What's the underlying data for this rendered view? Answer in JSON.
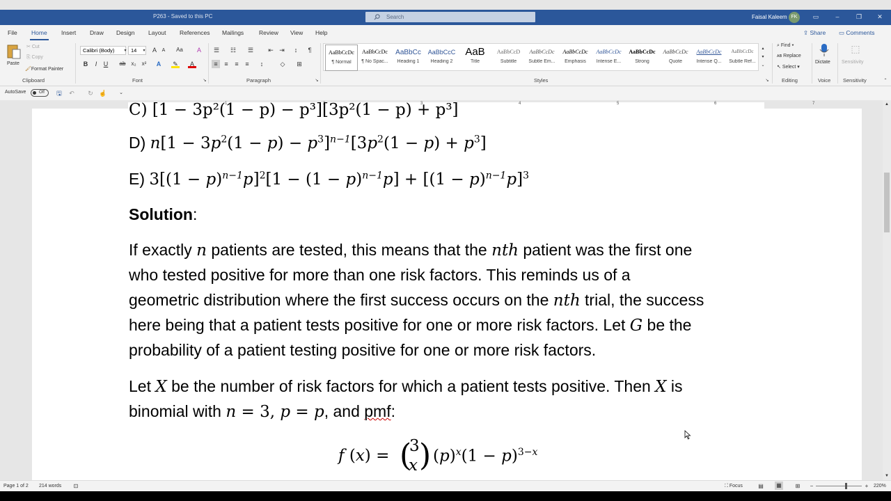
{
  "window": {
    "doc_title": "P263  -  Saved to this PC",
    "search_placeholder": "Search",
    "user_name": "Faisal Kaleem",
    "user_initials": "FK"
  },
  "tabs": [
    "File",
    "Home",
    "Insert",
    "Draw",
    "Design",
    "Layout",
    "References",
    "Mailings",
    "Review",
    "View",
    "Help"
  ],
  "active_tab": "Home",
  "share_label": "Share",
  "comments_label": "Comments",
  "ribbon": {
    "clipboard": {
      "paste": "Paste",
      "cut": "Cut",
      "copy": "Copy",
      "format_painter": "Format Painter",
      "label": "Clipboard"
    },
    "font": {
      "name": "Calibri (Body)",
      "size": "14",
      "label": "Font"
    },
    "paragraph": {
      "label": "Paragraph"
    },
    "styles": {
      "label": "Styles",
      "items": [
        {
          "preview": "AaBbCcDc",
          "name": "¶ Normal"
        },
        {
          "preview": "AaBbCcDc",
          "name": "¶ No Spac..."
        },
        {
          "preview": "AaBbCc",
          "name": "Heading 1"
        },
        {
          "preview": "AaBbCcC",
          "name": "Heading 2"
        },
        {
          "preview": "AaB",
          "name": "Title"
        },
        {
          "preview": "AaBbCcD",
          "name": "Subtitle"
        },
        {
          "preview": "AaBbCcDc",
          "name": "Subtle Em..."
        },
        {
          "preview": "AaBbCcDc",
          "name": "Emphasis"
        },
        {
          "preview": "AaBbCcDc",
          "name": "Intense E..."
        },
        {
          "preview": "AaBbCcDc",
          "name": "Strong"
        },
        {
          "preview": "AaBbCcDc",
          "name": "Quote"
        },
        {
          "preview": "AaBbCcDc",
          "name": "Intense Q..."
        },
        {
          "preview": "AaBbCcDc",
          "name": "Subtle Ref..."
        }
      ]
    },
    "editing": {
      "find": "Find",
      "replace": "Replace",
      "select": "Select",
      "label": "Editing"
    },
    "voice": {
      "dictate": "Dictate",
      "label": "Voice"
    },
    "sensitivity": {
      "button": "Sensitivity",
      "label": "Sensitivity"
    }
  },
  "qat": {
    "autosave": "AutoSave",
    "toggle": "Off"
  },
  "ruler_numbers": [
    "1",
    "2",
    "3",
    "4",
    "5",
    "6",
    "7"
  ],
  "document": {
    "option_e_label": "E)",
    "solution_heading": "Solution",
    "solution_colon": ":",
    "para1": {
      "l1a": "If exactly ",
      "l1b": "n",
      "l1c": " patients are tested, this means that the ",
      "l1d": "nth",
      "l1e": " patient was the first one",
      "l2": "who tested positive for more than one risk factors.  This reminds us of a",
      "l3a": "geometric distribution where the first success occurs on the ",
      "l3b": "nth",
      "l3c": " trial, the success",
      "l4a": "here being that a patient tests positive for one or more risk factors.  Let ",
      "l4b": "G",
      "l4c": " be the",
      "l5": "probability of a patient testing positive for one or more risk factors."
    },
    "para2": {
      "l1a": "Let ",
      "l1b": "X",
      "l1c": " be the number of risk factors for which a patient tests positive.  Then ",
      "l1d": "X",
      "l1e": " is",
      "l2a": "binomial with ",
      "l2b": "n",
      "l2c": " = 3, ",
      "l2d": "p",
      "l2e": " = ",
      "l2f": "p",
      "l2g": ", and ",
      "l2h": "pmf",
      "l2i": ":"
    }
  },
  "status": {
    "page": "Page 1 of 2",
    "words": "214 words",
    "focus": "Focus",
    "zoom": "220%"
  }
}
